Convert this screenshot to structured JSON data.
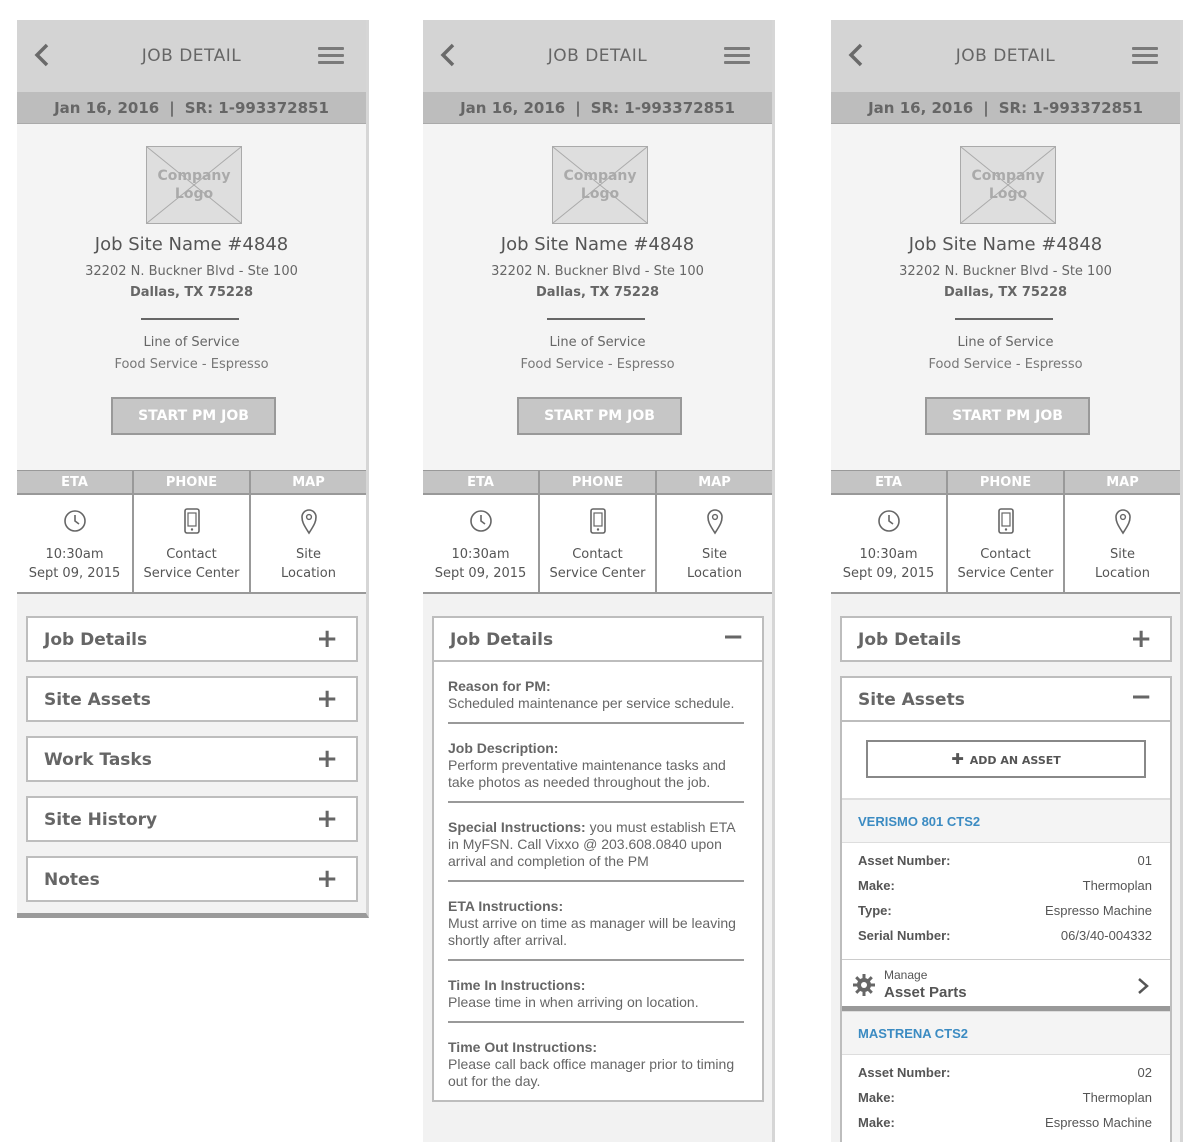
{
  "header": {
    "title": "JOB DETAIL"
  },
  "srbar": {
    "date": "Jan 16, 2016",
    "separator": "|",
    "sr": "SR: 1-993372851"
  },
  "site": {
    "logo_line1": "Company",
    "logo_line2": "Logo",
    "name": "Job Site Name #4848",
    "address1": "32202 N. Buckner Blvd - Ste 100",
    "address2": "Dallas, TX 75228",
    "los_label": "Line of Service",
    "los_value": "Food Service - Espresso",
    "start_button": "START PM JOB"
  },
  "columns": [
    {
      "head": "ETA",
      "icon": "clock-icon",
      "line1": "10:30am",
      "line2": "Sept 09, 2015"
    },
    {
      "head": "PHONE",
      "icon": "phone-icon",
      "line1": "Contact",
      "line2": "Service Center"
    },
    {
      "head": "MAP",
      "icon": "map-pin-icon",
      "line1": "Site",
      "line2": "Location"
    }
  ],
  "accordions": [
    {
      "label": "Job Details",
      "state": "+"
    },
    {
      "label": "Site Assets",
      "state": "+"
    },
    {
      "label": "Work Tasks",
      "state": "+"
    },
    {
      "label": "Site History",
      "state": "+"
    },
    {
      "label": "Notes",
      "state": "+"
    }
  ],
  "job_details_panel": {
    "label": "Job Details",
    "state": "−",
    "sections": [
      {
        "title": "Reason for PM:",
        "body": "Scheduled maintenance per service schedule."
      },
      {
        "title": "Job Description:",
        "body": "Perform preventative maintenance tasks and take photos as needed throughout the job."
      },
      {
        "title": "Special Instructions:",
        "body": " you must establish ETA in MyFSN. Call Vixxo @ 203.608.0840 upon arrival and completion of the PM"
      },
      {
        "title": "ETA Instructions:",
        "body": "Must arrive on time as manager will be leaving shortly after arrival."
      },
      {
        "title": "Time In Instructions:",
        "body": "Please time in when arriving on location."
      },
      {
        "title": "Time Out Instructions:",
        "body": "Please call back office manager prior to timing out for the day."
      }
    ]
  },
  "screen3": {
    "job_details": {
      "label": "Job Details",
      "state": "+"
    },
    "site_assets": {
      "label": "Site Assets",
      "state": "−"
    },
    "add_asset": "ADD AN ASSET",
    "assets": [
      {
        "name": "VERISMO 801 CTS2",
        "rows": [
          {
            "k": "Asset Number:",
            "v": "01"
          },
          {
            "k": "Make:",
            "v": "Thermoplan"
          },
          {
            "k": "Type:",
            "v": "Espresso Machine"
          },
          {
            "k": "Serial Number:",
            "v": "06/3/40-004332"
          }
        ]
      },
      {
        "name": "MASTRENA CTS2",
        "rows": [
          {
            "k": "Asset Number:",
            "v": "02"
          },
          {
            "k": "Make:",
            "v": "Thermoplan"
          },
          {
            "k": "Make:",
            "v": "Espresso Machine"
          }
        ]
      }
    ],
    "manage_small": "Manage",
    "manage_big": "Asset Parts"
  }
}
